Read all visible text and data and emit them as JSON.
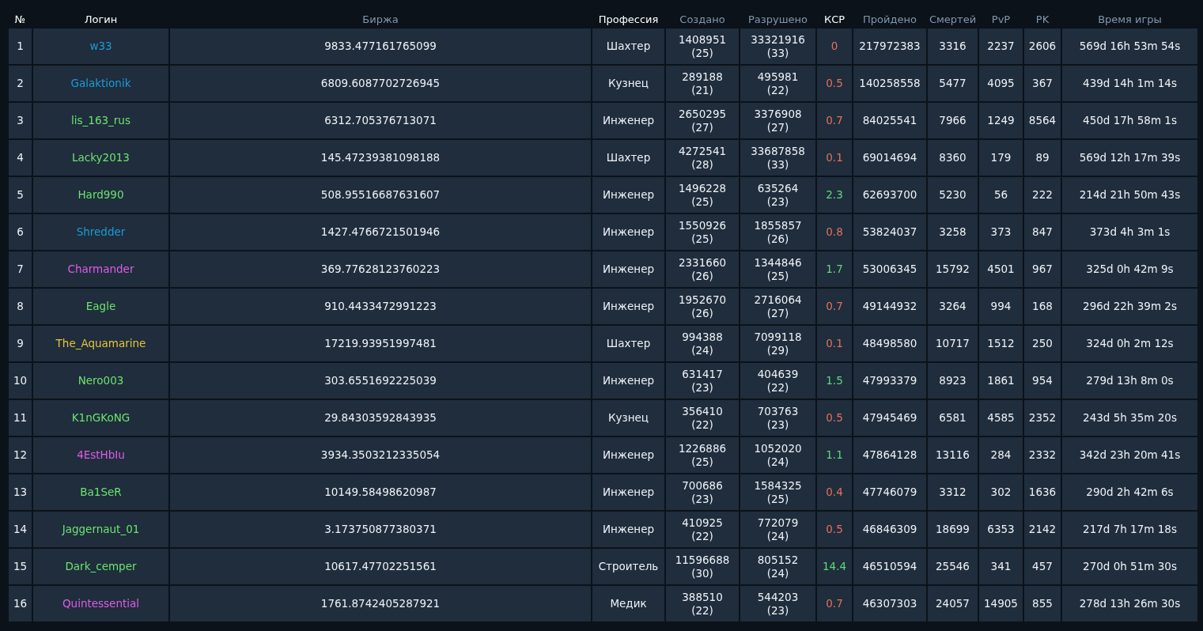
{
  "table": {
    "columns": [
      {
        "label": "№",
        "kind": "plain"
      },
      {
        "label": "Логин",
        "kind": "plain"
      },
      {
        "label": "Биржа",
        "kind": "sortable"
      },
      {
        "label": "Профессия",
        "kind": "plain"
      },
      {
        "label": "Создано",
        "kind": "sortable"
      },
      {
        "label": "Разрушено",
        "kind": "sortable"
      },
      {
        "label": "КСР",
        "kind": "plain"
      },
      {
        "label": "Пройдено",
        "kind": "sortable"
      },
      {
        "label": "Смертей",
        "kind": "sortable"
      },
      {
        "label": "PvP",
        "kind": "sortable"
      },
      {
        "label": "PK",
        "kind": "sortable"
      },
      {
        "label": "Время игры",
        "kind": "sortable"
      }
    ],
    "rows": [
      {
        "rank": "1",
        "login": {
          "text": "w33",
          "color": "#1e9bd7"
        },
        "exchange": "9833.477161765099",
        "profession": "Шахтер",
        "created": [
          "1408951",
          "(25)"
        ],
        "destroyed": [
          "33321916",
          "(33)"
        ],
        "ksr": {
          "text": "0",
          "color": "#e8705a"
        },
        "passed": "217972383",
        "deaths": "3316",
        "pvp": "2237",
        "pk": "2606",
        "playtime": "569d 16h 53m 54s"
      },
      {
        "rank": "2",
        "login": {
          "text": "Galaktionik",
          "color": "#1e9bd7"
        },
        "exchange": "6809.6087702726945",
        "profession": "Кузнец",
        "created": [
          "289188",
          "(21)"
        ],
        "destroyed": [
          "495981",
          "(22)"
        ],
        "ksr": {
          "text": "0.5",
          "color": "#e8705a"
        },
        "passed": "140258558",
        "deaths": "5477",
        "pvp": "4095",
        "pk": "367",
        "playtime": "439d 14h 1m 14s"
      },
      {
        "rank": "3",
        "login": {
          "text": "lis_163_rus",
          "color": "#6de36d"
        },
        "exchange": "6312.705376713071",
        "profession": "Инженер",
        "created": [
          "2650295",
          "(27)"
        ],
        "destroyed": [
          "3376908",
          "(27)"
        ],
        "ksr": {
          "text": "0.7",
          "color": "#e8705a"
        },
        "passed": "84025541",
        "deaths": "7966",
        "pvp": "1249",
        "pk": "8564",
        "playtime": "450d 17h 58m 1s"
      },
      {
        "rank": "4",
        "login": {
          "text": "Lacky2013",
          "color": "#6de36d"
        },
        "exchange": "145.47239381098188",
        "profession": "Шахтер",
        "created": [
          "4272541",
          "(28)"
        ],
        "destroyed": [
          "33687858",
          "(33)"
        ],
        "ksr": {
          "text": "0.1",
          "color": "#e8705a"
        },
        "passed": "69014694",
        "deaths": "8360",
        "pvp": "179",
        "pk": "89",
        "playtime": "569d 12h 17m 39s"
      },
      {
        "rank": "5",
        "login": {
          "text": "Hard990",
          "color": "#6de36d"
        },
        "exchange": "508.95516687631607",
        "profession": "Инженер",
        "created": [
          "1496228",
          "(25)"
        ],
        "destroyed": [
          "635264",
          "(23)"
        ],
        "ksr": {
          "text": "2.3",
          "color": "#5fd87a"
        },
        "passed": "62693700",
        "deaths": "5230",
        "pvp": "56",
        "pk": "222",
        "playtime": "214d 21h 50m 43s"
      },
      {
        "rank": "6",
        "login": {
          "text": "Shredder",
          "color": "#1e9bd7"
        },
        "exchange": "1427.4766721501946",
        "profession": "Инженер",
        "created": [
          "1550926",
          "(25)"
        ],
        "destroyed": [
          "1855857",
          "(26)"
        ],
        "ksr": {
          "text": "0.8",
          "color": "#e8705a"
        },
        "passed": "53824037",
        "deaths": "3258",
        "pvp": "373",
        "pk": "847",
        "playtime": "373d 4h 3m 1s"
      },
      {
        "rank": "7",
        "login": {
          "text": "Charmander",
          "color": "#e05ce8"
        },
        "exchange": "369.77628123760223",
        "profession": "Инженер",
        "created": [
          "2331660",
          "(26)"
        ],
        "destroyed": [
          "1344846",
          "(25)"
        ],
        "ksr": {
          "text": "1.7",
          "color": "#5fd87a"
        },
        "passed": "53006345",
        "deaths": "15792",
        "pvp": "4501",
        "pk": "967",
        "playtime": "325d 0h 42m 9s"
      },
      {
        "rank": "8",
        "login": {
          "text": "Eagle",
          "color": "#6de36d"
        },
        "exchange": "910.4433472991223",
        "profession": "Инженер",
        "created": [
          "1952670",
          "(26)"
        ],
        "destroyed": [
          "2716064",
          "(27)"
        ],
        "ksr": {
          "text": "0.7",
          "color": "#e8705a"
        },
        "passed": "49144932",
        "deaths": "3264",
        "pvp": "994",
        "pk": "168",
        "playtime": "296d 22h 39m 2s"
      },
      {
        "rank": "9",
        "login": {
          "text": "The_Aquamarine",
          "color": "#e8c23a"
        },
        "exchange": "17219.93951997481",
        "profession": "Шахтер",
        "created": [
          "994388",
          "(24)"
        ],
        "destroyed": [
          "7099118",
          "(29)"
        ],
        "ksr": {
          "text": "0.1",
          "color": "#e8705a"
        },
        "passed": "48498580",
        "deaths": "10717",
        "pvp": "1512",
        "pk": "250",
        "playtime": "324d 0h 2m 12s"
      },
      {
        "rank": "10",
        "login": {
          "text": "Nero003",
          "color": "#6de36d"
        },
        "exchange": "303.6551692225039",
        "profession": "Инженер",
        "created": [
          "631417",
          "(23)"
        ],
        "destroyed": [
          "404639",
          "(22)"
        ],
        "ksr": {
          "text": "1.5",
          "color": "#5fd87a"
        },
        "passed": "47993379",
        "deaths": "8923",
        "pvp": "1861",
        "pk": "954",
        "playtime": "279d 13h 8m 0s"
      },
      {
        "rank": "11",
        "login": {
          "text": "K1nGKoNG",
          "color": "#6de36d"
        },
        "exchange": "29.84303592843935",
        "profession": "Кузнец",
        "created": [
          "356410",
          "(22)"
        ],
        "destroyed": [
          "703763",
          "(23)"
        ],
        "ksr": {
          "text": "0.5",
          "color": "#e8705a"
        },
        "passed": "47945469",
        "deaths": "6581",
        "pvp": "4585",
        "pk": "2352",
        "playtime": "243d 5h 35m 20s"
      },
      {
        "rank": "12",
        "login": {
          "text": "4EstHbIu",
          "color": "#e05ce8"
        },
        "exchange": "3934.3503212335054",
        "profession": "Инженер",
        "created": [
          "1226886",
          "(25)"
        ],
        "destroyed": [
          "1052020",
          "(24)"
        ],
        "ksr": {
          "text": "1.1",
          "color": "#5fd87a"
        },
        "passed": "47864128",
        "deaths": "13116",
        "pvp": "284",
        "pk": "2332",
        "playtime": "342d 23h 20m 41s"
      },
      {
        "rank": "13",
        "login": {
          "text": "Ba1SeR",
          "color": "#6de36d"
        },
        "exchange": "10149.58498620987",
        "profession": "Инженер",
        "created": [
          "700686",
          "(23)"
        ],
        "destroyed": [
          "1584325",
          "(25)"
        ],
        "ksr": {
          "text": "0.4",
          "color": "#e8705a"
        },
        "passed": "47746079",
        "deaths": "3312",
        "pvp": "302",
        "pk": "1636",
        "playtime": "290d 2h 42m 6s"
      },
      {
        "rank": "14",
        "login": {
          "text": "Jaggernaut_01",
          "color": "#6de36d"
        },
        "exchange": "3.173750877380371",
        "profession": "Инженер",
        "created": [
          "410925",
          "(22)"
        ],
        "destroyed": [
          "772079",
          "(24)"
        ],
        "ksr": {
          "text": "0.5",
          "color": "#e8705a"
        },
        "passed": "46846309",
        "deaths": "18699",
        "pvp": "6353",
        "pk": "2142",
        "playtime": "217d 7h 17m 18s"
      },
      {
        "rank": "15",
        "login": {
          "text": "Dark_cemper",
          "color": "#6de36d"
        },
        "exchange": "10617.47702251561",
        "profession": "Строитель",
        "created": [
          "11596688",
          "(30)"
        ],
        "destroyed": [
          "805152",
          "(24)"
        ],
        "ksr": {
          "text": "14.4",
          "color": "#5fd87a"
        },
        "passed": "46510594",
        "deaths": "25546",
        "pvp": "341",
        "pk": "457",
        "playtime": "270d 0h 51m 30s"
      },
      {
        "rank": "16",
        "login": {
          "text": "Quintessential",
          "color": "#e05ce8"
        },
        "exchange": "1761.8742405287921",
        "profession": "Медик",
        "created": [
          "388510",
          "(22)"
        ],
        "destroyed": [
          "544203",
          "(23)"
        ],
        "ksr": {
          "text": "0.7",
          "color": "#e8705a"
        },
        "passed": "46307303",
        "deaths": "24057",
        "pvp": "14905",
        "pk": "855",
        "playtime": "278d 13h 26m 30s"
      }
    ]
  }
}
